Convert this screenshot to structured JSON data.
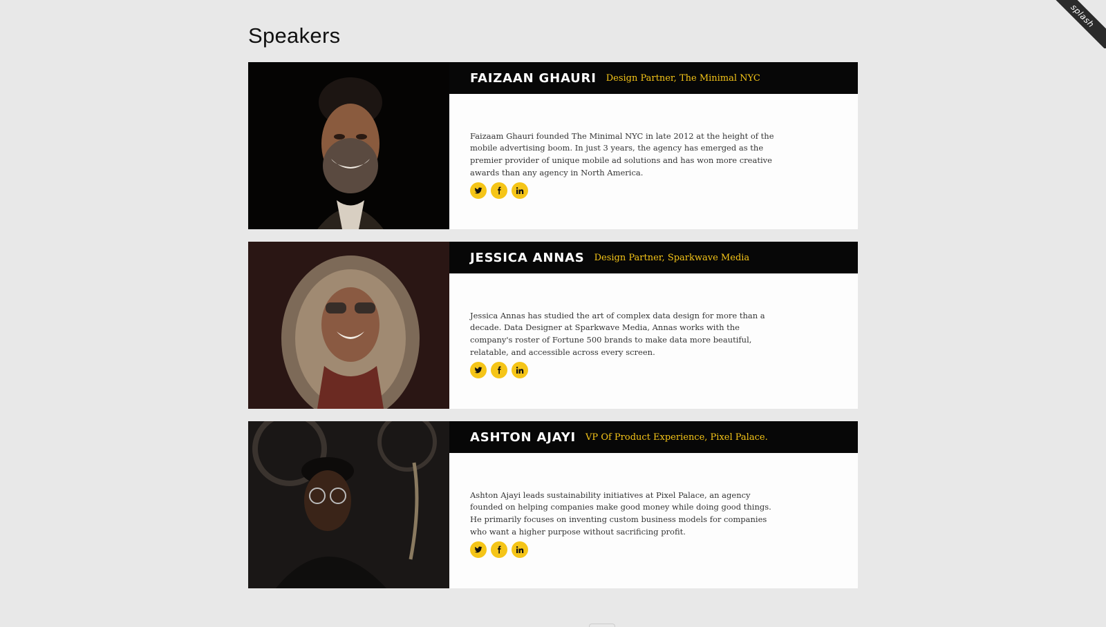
{
  "ribbon": {
    "label": "splash"
  },
  "page": {
    "title": "Speakers"
  },
  "colors": {
    "accent": "#f5c518",
    "header_bg": "#070707",
    "page_bg": "#e8e8e8"
  },
  "speakers": [
    {
      "name": "FAIZAAN GHAURI",
      "role": "Design Partner, The Minimal NYC",
      "bio": "Faizaam Ghauri founded The Minimal NYC in late 2012 at the height of the mobile advertising boom. In just 3 years, the agency has emerged as the premier provider of unique mobile ad solutions and has won more creative awards than any agency in North America.",
      "photo_icon": "speaker-photo-smiling-man",
      "socials": [
        "twitter-icon",
        "facebook-icon",
        "linkedin-icon"
      ]
    },
    {
      "name": "JESSICA ANNAS",
      "role": "Design Partner, Sparkwave Media",
      "bio": "Jessica Annas has studied the art of complex data design for more than a decade. Data Designer at Sparkwave Media, Annas works with the company's roster of Fortune 500 brands to make data more beautiful, relatable, and accessible across every screen.",
      "photo_icon": "speaker-photo-woman-fur-hood",
      "socials": [
        "twitter-icon",
        "facebook-icon",
        "linkedin-icon"
      ]
    },
    {
      "name": "ASHTON AJAYI",
      "role": "VP Of Product Experience, Pixel Palace.",
      "bio": "Ashton Ajayi leads sustainability initiatives at Pixel Palace, an agency founded on helping companies make good money while doing good things. He primarily focuses on inventing custom business models for companies who want a higher purpose without sacrificing profit.",
      "photo_icon": "speaker-photo-man-glasses",
      "socials": [
        "twitter-icon",
        "facebook-icon",
        "linkedin-icon"
      ]
    }
  ]
}
